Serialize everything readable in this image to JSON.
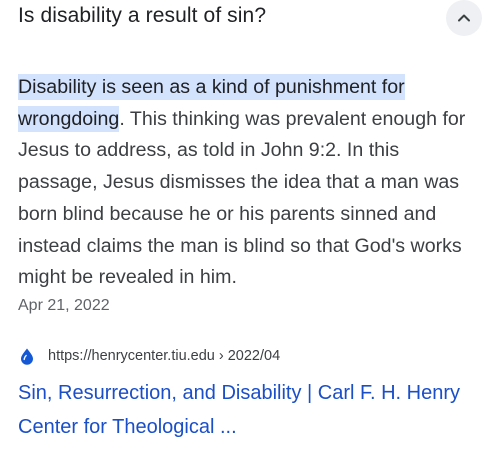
{
  "question": {
    "text": "Is disability a result of sin?"
  },
  "answer": {
    "highlight": "Disability is seen as a kind of punishment for wrongdoing",
    "body": ". This thinking was prevalent enough for Jesus to address, as told in John 9:2. In this passage, Jesus dismisses the idea that a man was born blind because he or his parents sinned and instead claims the man is blind so that God's works might be revealed in him.",
    "date": "Apr 21, 2022"
  },
  "source": {
    "favicon_icon": "water-drop-icon",
    "url": "https://henrycenter.tiu.edu › 2022/04",
    "title": "Sin, Resurrection, and Disability | Carl F. H. Henry Center for Theological ..."
  },
  "colors": {
    "highlight_bg": "#d3e3fd",
    "link": "#1a4fc8",
    "favicon": "#1558d6"
  }
}
